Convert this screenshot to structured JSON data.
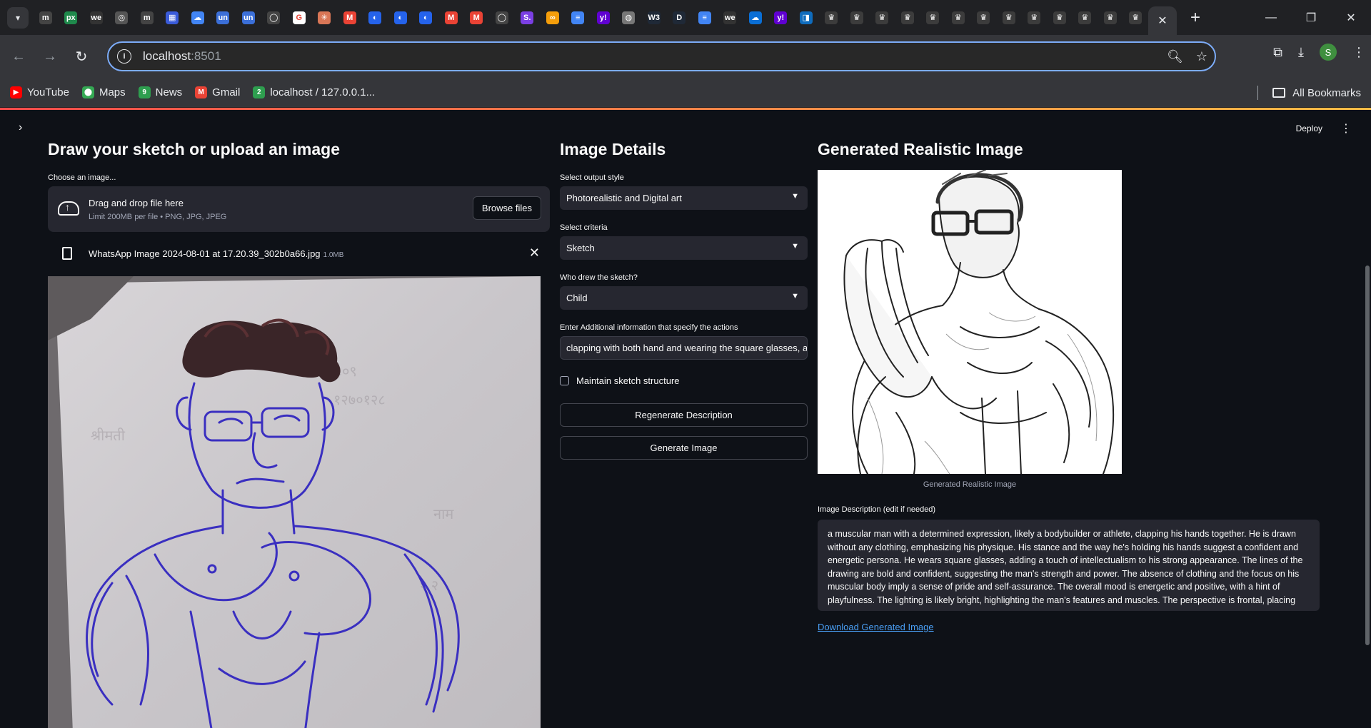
{
  "browser": {
    "tab_favicons": [
      "m",
      "px",
      "we",
      "◎",
      "m",
      "▦",
      "☁",
      "un",
      "un",
      "◯",
      "G",
      "✳",
      "M",
      "◐",
      "◐",
      "◐",
      "M",
      "M",
      "◯",
      "S.",
      "∞",
      "≡",
      "y!",
      "◍",
      "W3",
      "D",
      "≡",
      "we",
      "☁",
      "y!",
      "◨",
      "♛",
      "♛",
      "♛",
      "♛",
      "♛",
      "♛",
      "♛",
      "♛",
      "♛",
      "♛",
      "♛",
      "♛",
      "♛"
    ],
    "url_host": "localhost",
    "url_port": ":8501",
    "bookmarks": [
      {
        "label": "YouTube",
        "color": "#ff0000",
        "glyph": "▶"
      },
      {
        "label": "Maps",
        "color": "#34a853",
        "glyph": "⬤"
      },
      {
        "label": "News",
        "color": "#2e9e4f",
        "glyph": "9"
      },
      {
        "label": "Gmail",
        "color": "#ea4335",
        "glyph": "M"
      },
      {
        "label": "localhost / 127.0.0.1...",
        "color": "#2e9e4f",
        "glyph": "2"
      }
    ],
    "all_bookmarks": "All Bookmarks",
    "profile_initial": "S"
  },
  "app": {
    "deploy": "Deploy",
    "left": {
      "title": "Draw your sketch or upload an image",
      "uploader_label": "Choose an image...",
      "dropzone_main": "Drag and drop file here",
      "dropzone_sub": "Limit 200MB per file • PNG, JPG, JPEG",
      "browse": "Browse files",
      "file_name": "WhatsApp Image 2024-08-01 at 17.20.39_302b0a66.jpg",
      "file_size": "1.0MB"
    },
    "middle": {
      "title": "Image Details",
      "style_label": "Select output style",
      "style_value": "Photorealistic and Digital art",
      "criteria_label": "Select criteria",
      "criteria_value": "Sketch",
      "who_label": "Who drew the sketch?",
      "who_value": "Child",
      "info_label": "Enter Additional information that specify the actions",
      "info_value": "clapping with both hand and wearing the square glasses, and",
      "maintain_label": "Maintain sketch structure",
      "regenerate": "Regenerate Description",
      "generate": "Generate Image"
    },
    "right": {
      "title": "Generated Realistic Image",
      "caption": "Generated Realistic Image",
      "desc_label": "Image Description (edit if needed)",
      "description": "a muscular man with a determined expression, likely a bodybuilder or athlete, clapping his hands together. He is drawn without any clothing, emphasizing his physique. His stance and the way he's holding his hands suggest a confident and energetic persona. He wears square glasses, adding a touch of intellectualism to his strong appearance. The lines of the drawing are bold and confident, suggesting the man's strength and power. The absence of clothing and the focus on his muscular body imply a sense of pride and self-assurance. The overall mood is energetic and positive, with a hint of playfulness. The lighting is likely bright, highlighting the man's features and muscles. The perspective is frontal, placing",
      "download": "Download Generated Image"
    }
  }
}
